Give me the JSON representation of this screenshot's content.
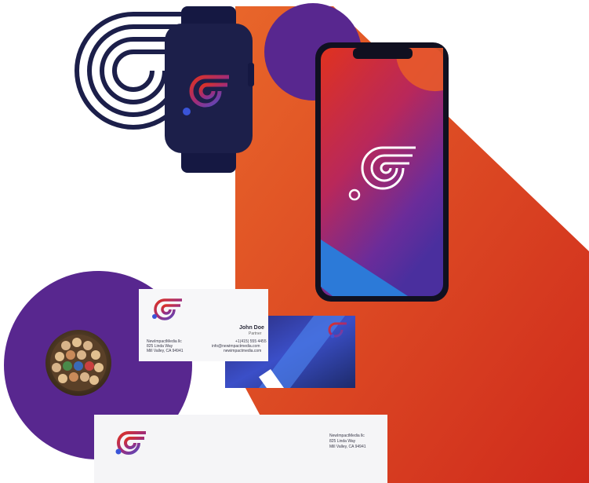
{
  "business_card": {
    "company": "NewImpactMedia llc",
    "address_line1": "825 Linda Way",
    "address_line2": "Mill Valley, CA 94941",
    "name": "John Doe",
    "title": "Partner",
    "phone": "+1(415) 555 4455",
    "email": "info@newimpactmedia.com",
    "website": "newimpactmedia.com"
  },
  "letterhead": {
    "company": "NewImpactMedia llc",
    "address_line1": "825 Linda Way",
    "address_line2": "Mill Valley, CA 94941"
  },
  "colors": {
    "navy": "#1c1f4a",
    "purple": "#58278f",
    "orange": "#e2552a",
    "red": "#d62c1f",
    "blue": "#2d6fd6"
  }
}
